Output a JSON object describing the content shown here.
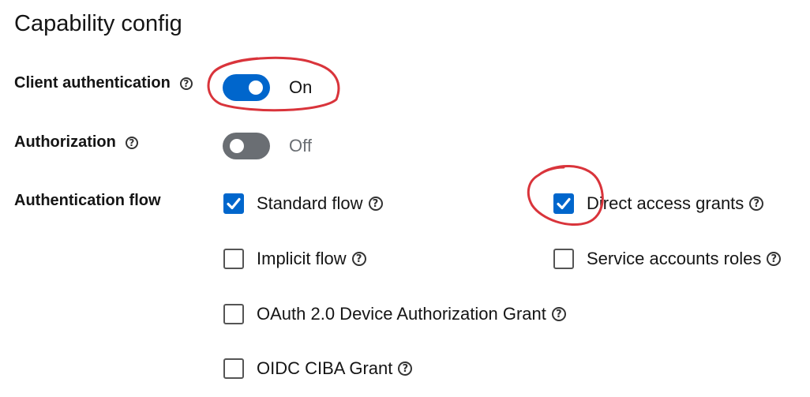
{
  "section": {
    "title": "Capability config"
  },
  "rows": {
    "client_auth": {
      "label": "Client authentication",
      "state_text": "On",
      "value": true
    },
    "authorization": {
      "label": "Authorization",
      "state_text": "Off",
      "value": false
    },
    "auth_flow": {
      "label": "Authentication flow"
    }
  },
  "flows": {
    "standard": {
      "label": "Standard flow",
      "checked": true
    },
    "direct": {
      "label": "Direct access grants",
      "checked": true
    },
    "implicit": {
      "label": "Implicit flow",
      "checked": false
    },
    "service": {
      "label": "Service accounts roles",
      "checked": false
    },
    "device": {
      "label": "OAuth 2.0 Device Authorization Grant",
      "checked": false
    },
    "ciba": {
      "label": "OIDC CIBA Grant",
      "checked": false
    }
  },
  "icons": {
    "help": "?"
  },
  "colors": {
    "accent": "#0066cc",
    "off": "#6a6e73",
    "annotation": "#d9343b"
  }
}
